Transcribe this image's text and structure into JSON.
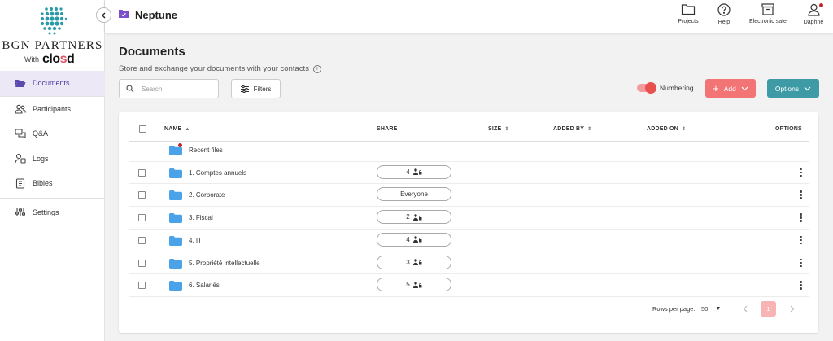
{
  "brand": {
    "name": "BGN PARTNERS",
    "with": "With",
    "product": "clo",
    "product_s": "s",
    "product_end": "d"
  },
  "sidebar": {
    "items": [
      {
        "label": "Documents",
        "icon": "folder-open-icon",
        "active": true
      },
      {
        "label": "Participants",
        "icon": "users-icon"
      },
      {
        "label": "Q&A",
        "icon": "chat-icon"
      },
      {
        "label": "Logs",
        "icon": "log-icon"
      },
      {
        "label": "Bibles",
        "icon": "book-icon"
      },
      {
        "label": "Settings",
        "icon": "sliders-icon"
      }
    ]
  },
  "topbar": {
    "project": "Neptune",
    "icons": [
      {
        "label": "Projects",
        "icon": "folder-icon"
      },
      {
        "label": "Help",
        "icon": "help-icon"
      },
      {
        "label": "Electronic safe",
        "icon": "archive-icon"
      },
      {
        "label": "Daphné",
        "icon": "user-icon"
      }
    ]
  },
  "page": {
    "title": "Documents",
    "subtitle": "Store and exchange your documents with your contacts",
    "info": "i"
  },
  "toolbar": {
    "search_placeholder": "Search",
    "filters": "Filters",
    "numbering": "Numbering",
    "add": "Add",
    "options": "Options"
  },
  "table": {
    "headers": {
      "name": "NAME",
      "share": "SHARE",
      "size": "SIZE",
      "added_by": "ADDED BY",
      "added_on": "ADDED ON",
      "options": "OPTIONS"
    },
    "recent": "Recent files",
    "rows": [
      {
        "name": "1. Comptes annuels",
        "share": "4"
      },
      {
        "name": "2. Corporate",
        "share": "Everyone"
      },
      {
        "name": "3. Fiscal",
        "share": "2"
      },
      {
        "name": "4. IT",
        "share": "4"
      },
      {
        "name": "5. Propriété intellectuelle",
        "share": "3"
      },
      {
        "name": "6. Salariés",
        "share": "5"
      }
    ]
  },
  "pagination": {
    "rows_label": "Rows per page:",
    "rows_value": "50",
    "page": "1"
  },
  "colors": {
    "accent": "#4a3aa0",
    "add": "#f37474",
    "options": "#3e9aa5",
    "teal": "#2a9aa8"
  }
}
